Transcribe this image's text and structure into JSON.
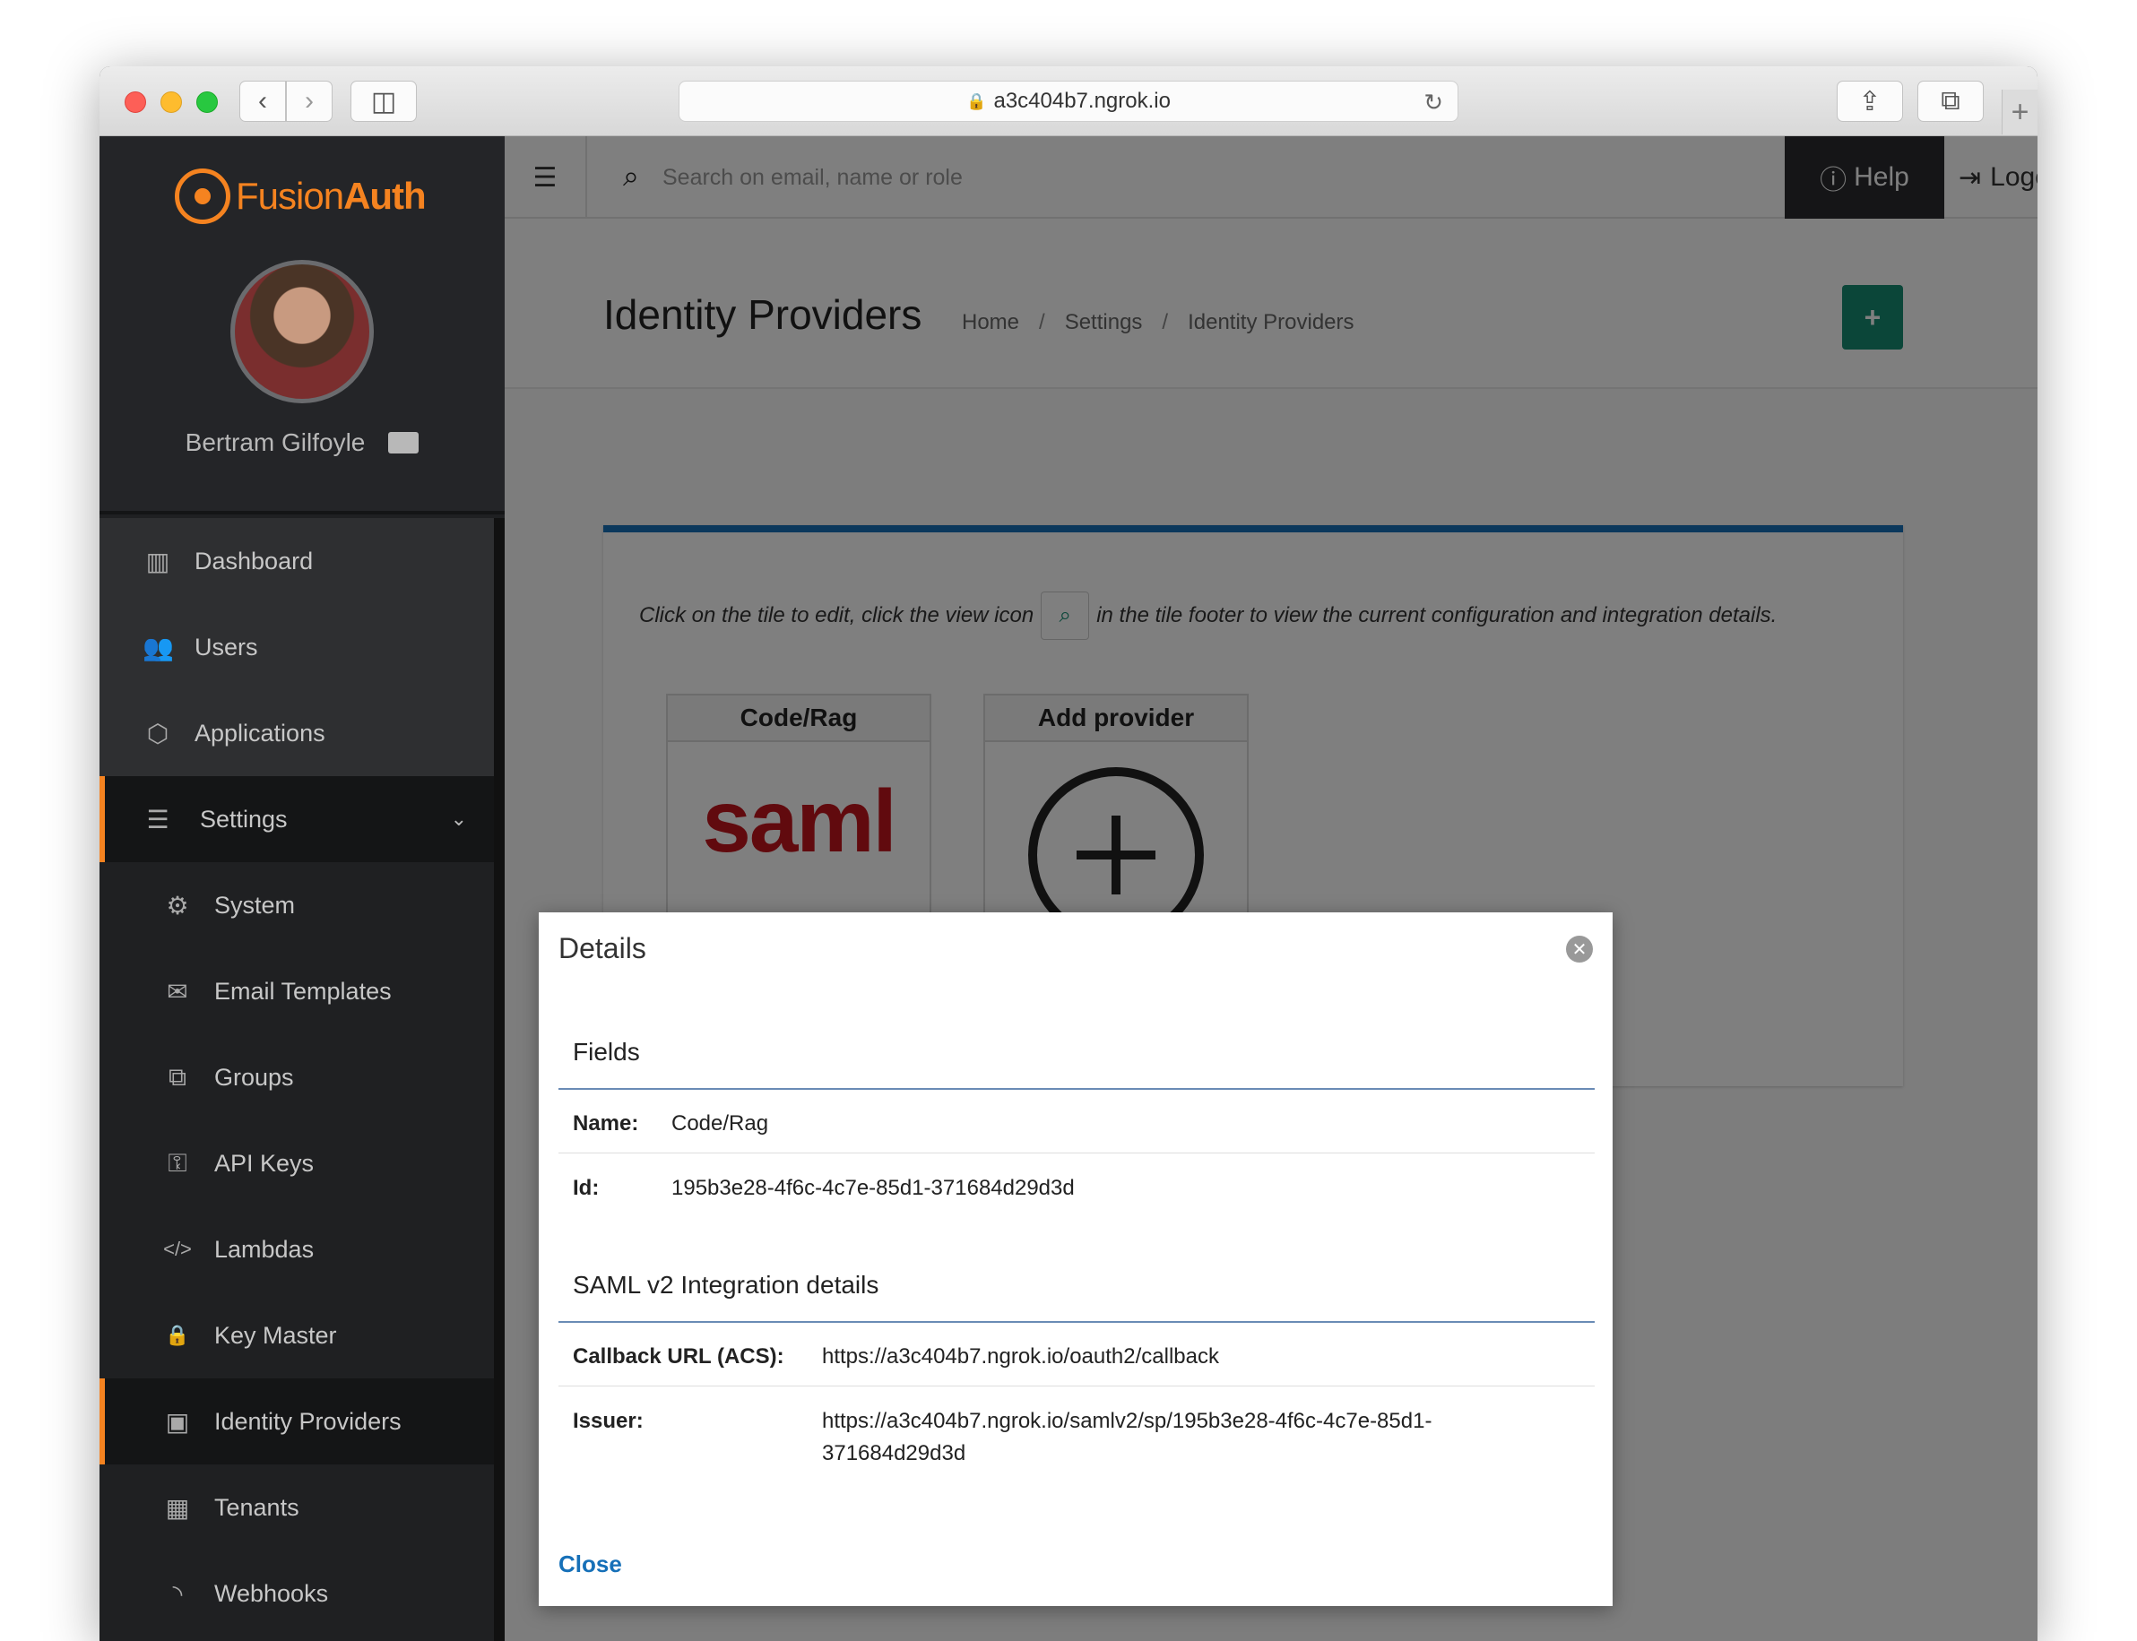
{
  "browser": {
    "url": "a3c404b7.ngrok.io",
    "new_tab": "+"
  },
  "sidebar": {
    "brand_fusion": "Fusion",
    "brand_auth": "Auth",
    "user_name": "Bertram Gilfoyle",
    "items": [
      {
        "label": "Dashboard",
        "icon": "dashboard-icon",
        "glyph": "▥"
      },
      {
        "label": "Users",
        "icon": "users-icon",
        "glyph": "👥"
      },
      {
        "label": "Applications",
        "icon": "cube-icon",
        "glyph": "⬡"
      },
      {
        "label": "Settings",
        "icon": "sliders-icon",
        "glyph": "☰"
      },
      {
        "label": "System",
        "icon": "gear-icon",
        "glyph": "⚙"
      },
      {
        "label": "Email Templates",
        "icon": "envelope-icon",
        "glyph": "✉"
      },
      {
        "label": "Groups",
        "icon": "groups-icon",
        "glyph": "⧉"
      },
      {
        "label": "API Keys",
        "icon": "key-icon",
        "glyph": "⚿"
      },
      {
        "label": "Lambdas",
        "icon": "code-icon",
        "glyph": "</>"
      },
      {
        "label": "Key Master",
        "icon": "lock-icon",
        "glyph": "🔒"
      },
      {
        "label": "Identity Providers",
        "icon": "id-badge-icon",
        "glyph": "▣"
      },
      {
        "label": "Tenants",
        "icon": "building-icon",
        "glyph": "▦"
      },
      {
        "label": "Webhooks",
        "icon": "rss-icon",
        "glyph": "◝"
      }
    ]
  },
  "topbar": {
    "search_placeholder": "Search on email, name or role",
    "help_label": "Help",
    "logout_label": "Logout"
  },
  "page": {
    "title": "Identity Providers",
    "breadcrumbs": [
      "Home",
      "Settings",
      "Identity Providers"
    ],
    "add_label": "+"
  },
  "panel": {
    "info_before": "Click on the tile to edit, click the view icon",
    "info_after": "in the tile footer to view the current configuration and integration details.",
    "tiles": [
      {
        "title": "Code/Rag",
        "logo_text": "saml"
      },
      {
        "title": "Add provider"
      }
    ]
  },
  "modal": {
    "title": "Details",
    "fields_heading": "Fields",
    "name_label": "Name:",
    "name_value": "Code/Rag",
    "id_label": "Id:",
    "id_value": "195b3e28-4f6c-4c7e-85d1-371684d29d3d",
    "saml_heading": "SAML v2 Integration details",
    "callback_label": "Callback URL (ACS):",
    "callback_value": "https://a3c404b7.ngrok.io/oauth2/callback",
    "issuer_label": "Issuer:",
    "issuer_value_line1": "https://a3c404b7.ngrok.io/samlv2/sp/195b3e28-4f6c-4c7e-85d1-",
    "issuer_value_line2": "371684d29d3d",
    "close_label": "Close"
  },
  "colors": {
    "accent": "#f58320",
    "primary_blue": "#1670b8",
    "success_green": "#178d73",
    "saml_red": "#c3151c"
  }
}
